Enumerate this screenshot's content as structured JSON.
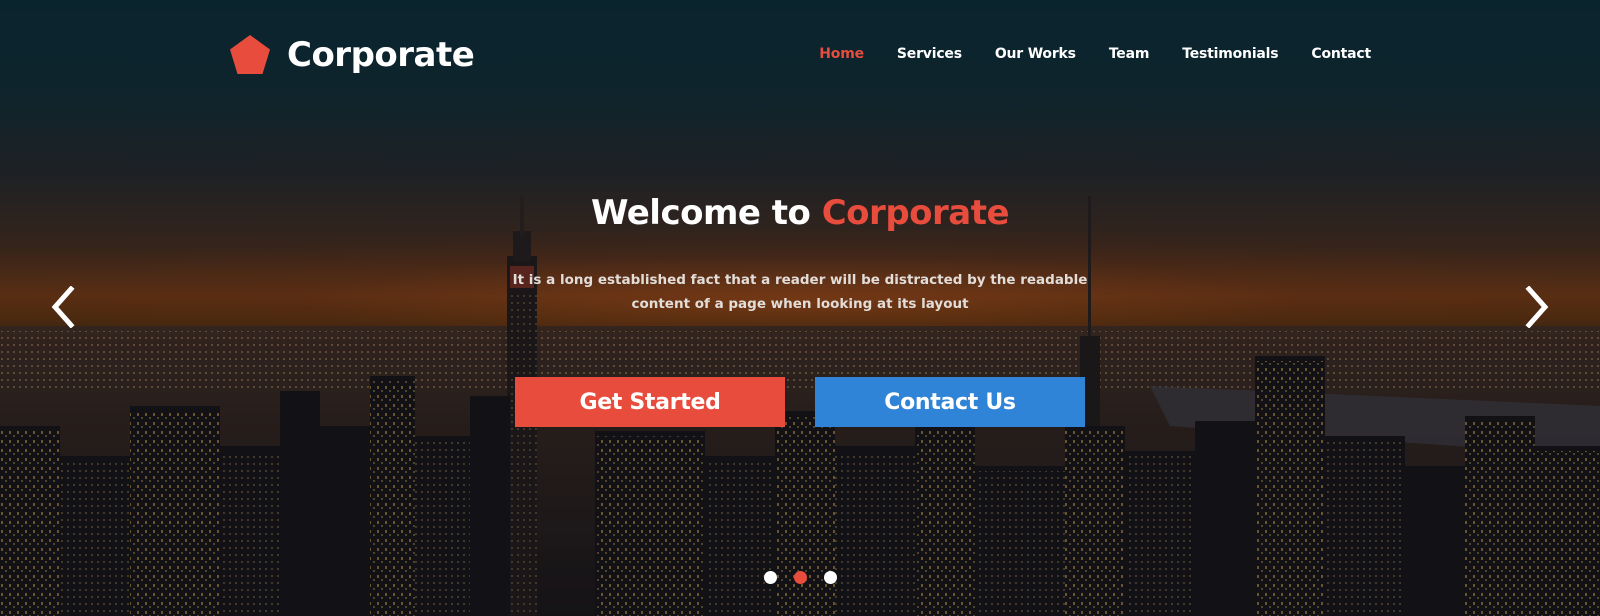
{
  "brand": {
    "name": "Corporate",
    "icon": "pentagon-logo-icon",
    "icon_color": "#e84c3d"
  },
  "nav": {
    "items": [
      {
        "label": "Home",
        "active": true
      },
      {
        "label": "Services",
        "active": false
      },
      {
        "label": "Our Works",
        "active": false
      },
      {
        "label": "Team",
        "active": false
      },
      {
        "label": "Testimonials",
        "active": false
      },
      {
        "label": "Contact",
        "active": false
      }
    ]
  },
  "hero": {
    "headline_prefix": "Welcome to ",
    "headline_accent": "Corporate",
    "subtext_line1": "It is a long established fact that a reader will be distracted by the readable",
    "subtext_line2": "content of a page when looking at its layout",
    "primary_button": "Get Started",
    "secondary_button": "Contact Us"
  },
  "slider": {
    "prev_icon": "chevron-left-icon",
    "next_icon": "chevron-right-icon",
    "dots_count": 3,
    "active_dot": 2
  },
  "colors": {
    "accent": "#e84c3d",
    "secondary": "#2f84d8",
    "text": "#ffffff"
  }
}
